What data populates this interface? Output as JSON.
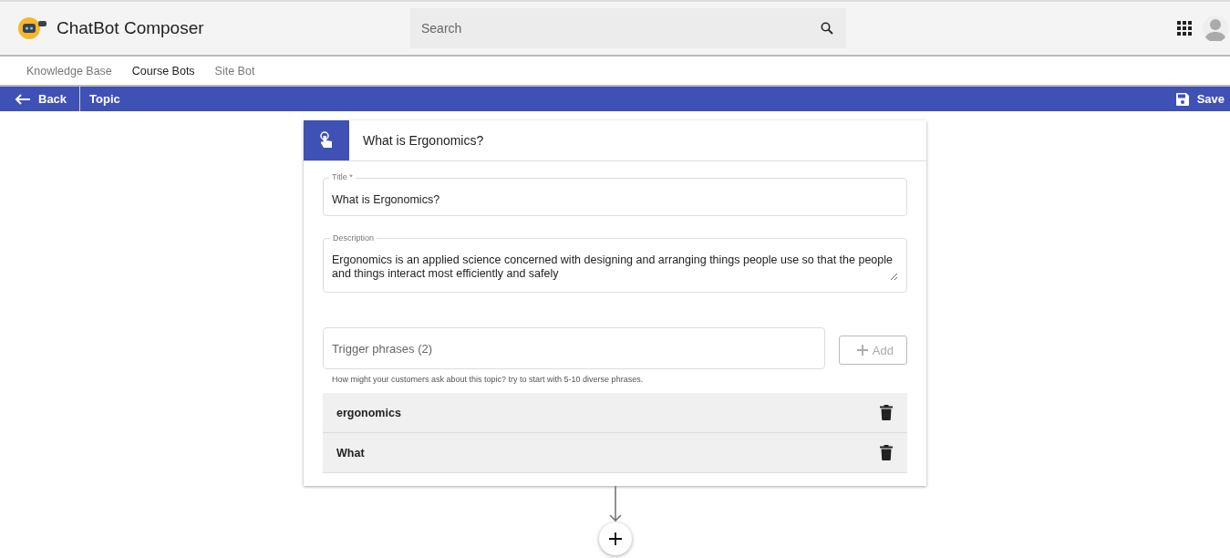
{
  "header": {
    "app_title": "ChatBot Composer",
    "search": {
      "placeholder": "Search"
    }
  },
  "tabs": [
    {
      "label": "Knowledge Base",
      "selected": false
    },
    {
      "label": "Course Bots",
      "selected": true
    },
    {
      "label": "Site Bot",
      "selected": false
    }
  ],
  "toolbar": {
    "back": "Back",
    "title": "Topic",
    "save": "Save"
  },
  "card": {
    "heading": "What is Ergonomics?",
    "title_field": {
      "label": "Title *",
      "value": "What is Ergonomics?"
    },
    "description_field": {
      "label": "Description",
      "value": "Ergonomics is an applied science concerned with designing and arranging things people use so that the people and things interact most efficiently and safely"
    },
    "trigger_field": {
      "placeholder": "Trigger phrases (2)"
    },
    "add_button": {
      "label": "Add",
      "disabled": true
    },
    "hint": "How might your customers ask about this topic? try to start with 5-10 diverse phrases.",
    "phrases": [
      {
        "text": "ergonomics"
      },
      {
        "text": "What"
      }
    ]
  }
}
